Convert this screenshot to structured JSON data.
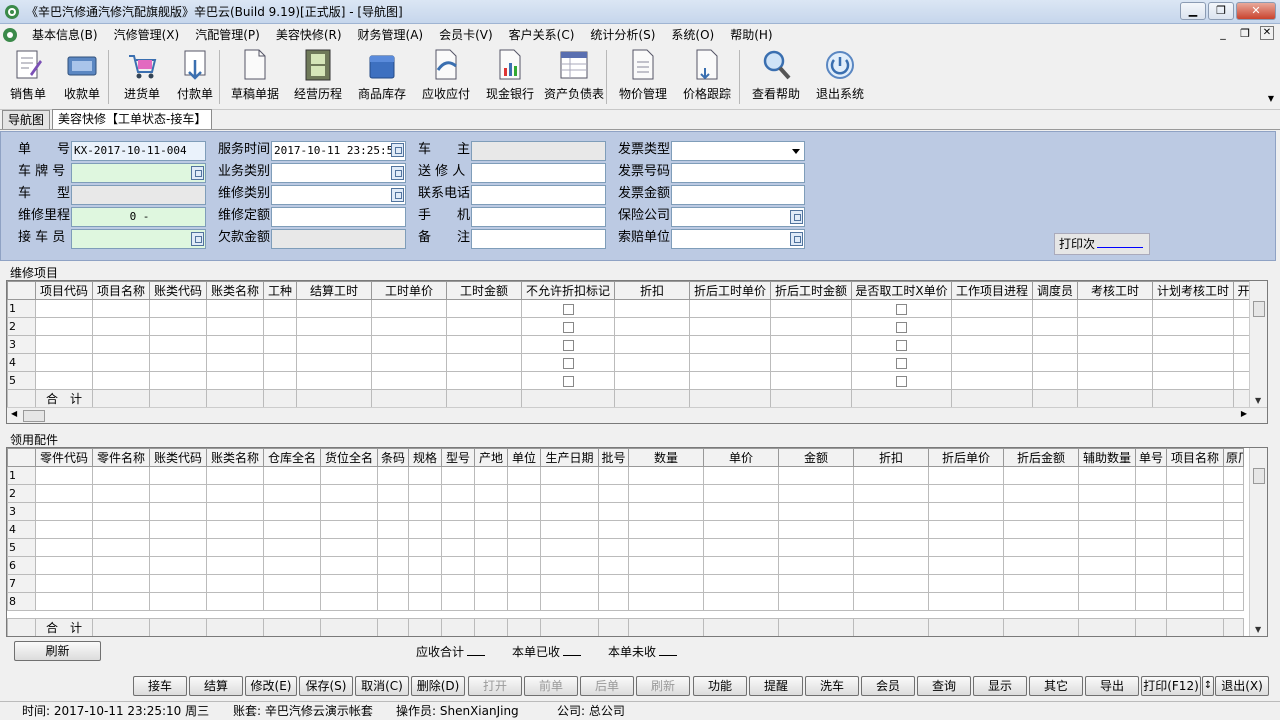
{
  "window": {
    "title": "《辛巴汽修通汽修汽配旗舰版》辛巴云(Build 9.19)[正式版] - [导航图]"
  },
  "menu": [
    "基本信息(B)",
    "汽修管理(X)",
    "汽配管理(P)",
    "美容快修(R)",
    "财务管理(A)",
    "会员卡(V)",
    "客户关系(C)",
    "统计分析(S)",
    "系统(O)",
    "帮助(H)"
  ],
  "toolbar": [
    {
      "label": "销售单",
      "icon": "sales-order-icon"
    },
    {
      "label": "收款单",
      "icon": "receipt-icon"
    },
    {
      "label": "进货单",
      "icon": "purchase-cart-icon"
    },
    {
      "label": "付款单",
      "icon": "payment-icon"
    },
    {
      "label": "草稿单据",
      "icon": "draft-document-icon"
    },
    {
      "label": "经营历程",
      "icon": "film-history-icon"
    },
    {
      "label": "商品库存",
      "icon": "inventory-box-icon"
    },
    {
      "label": "应收应付",
      "icon": "receivable-icon"
    },
    {
      "label": "现金银行",
      "icon": "cash-bank-icon"
    },
    {
      "label": "资产负债表",
      "icon": "balance-sheet-icon"
    },
    {
      "label": "物价管理",
      "icon": "price-management-icon"
    },
    {
      "label": "价格跟踪",
      "icon": "price-tracking-icon"
    },
    {
      "label": "查看帮助",
      "icon": "help-magnifier-icon"
    },
    {
      "label": "退出系统",
      "icon": "exit-icon"
    }
  ],
  "tabs": [
    "导航图",
    "美容快修【工单状态-接车】"
  ],
  "form": {
    "order_no_label": "单　　号",
    "order_no": "KX-2017-10-11-004",
    "plate_label": "车 牌 号",
    "model_label": "车　　型",
    "mileage_label": "维修里程",
    "mileage": "0 -",
    "receiver_label": "接 车 员",
    "service_time_label": "服务时间",
    "service_time": "2017-10-11 23:25:50",
    "biz_type_label": "业务类别",
    "repair_type_label": "维修类别",
    "repair_quota_label": "维修定额",
    "arrears_label": "欠款金额",
    "owner_label": "车　　主",
    "sender_label": "送 修 人",
    "phone_label": "联系电话",
    "mobile_label": "手　　机",
    "remark_label": "备　　注",
    "invoice_type_label": "发票类型",
    "invoice_no_label": "发票号码",
    "invoice_amount_label": "发票金额",
    "insurer_label": "保险公司",
    "claim_unit_label": "索赔单位",
    "print_count_label": "打印次"
  },
  "repair_items": {
    "title": "维修项目",
    "columns": [
      "项目代码",
      "项目名称",
      "账类代码",
      "账类名称",
      "工种",
      "结算工时",
      "工时单价",
      "工时金额",
      "不允许折扣标记",
      "折扣",
      "折后工时单价",
      "折后工时金额",
      "是否取工时X单价",
      "工作项目进程",
      "调度员",
      "考核工时",
      "计划考核工时",
      "开"
    ],
    "rows": [
      "1",
      "2",
      "3",
      "4",
      "5"
    ],
    "total_label": "合　计"
  },
  "parts": {
    "title": "领用配件",
    "columns": [
      "零件代码",
      "零件名称",
      "账类代码",
      "账类名称",
      "仓库全名",
      "货位全名",
      "条码",
      "规格",
      "型号",
      "产地",
      "单位",
      "生产日期",
      "批号",
      "数量",
      "单价",
      "金额",
      "折扣",
      "折后单价",
      "折后金额",
      "辅助数量",
      "单号",
      "项目名称",
      "原厂"
    ],
    "rows": [
      "1",
      "2",
      "3",
      "4",
      "5",
      "6",
      "7",
      "8"
    ],
    "total_label": "合　计"
  },
  "summary": {
    "refresh": "刷新",
    "receivable": "应收合计",
    "received": "本单已收",
    "unreceived": "本单未收"
  },
  "actions": [
    "接车",
    "结算",
    "修改(E)",
    "保存(S)",
    "取消(C)",
    "删除(D)",
    "打开",
    "前单",
    "后单",
    "刷新",
    "功能",
    "提醒",
    "洗车",
    "会员",
    "查询",
    "显示",
    "其它",
    "导出",
    "打印(F12)",
    "退出(X)"
  ],
  "status": {
    "time": "时间: 2017-10-11 23:25:10 周三",
    "account": "账套: 辛巴汽修云演示帐套",
    "operator": "操作员: ShenXianJing",
    "company": "公司: 总公司"
  },
  "colors": {
    "form_bg": "#bccae3",
    "green_field": "#dff7df"
  }
}
